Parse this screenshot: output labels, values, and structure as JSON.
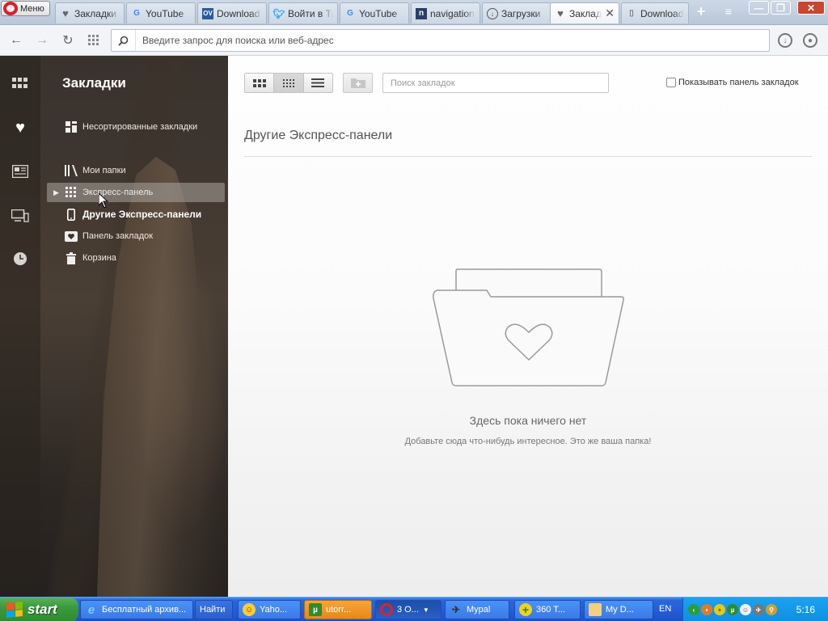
{
  "browser": {
    "menu_label": "Меню",
    "tabs": [
      {
        "label": "Закладки",
        "icon": "heart-icon"
      },
      {
        "label": "YouTube",
        "icon": "google-icon"
      },
      {
        "label": "Download",
        "icon": "ov-icon"
      },
      {
        "label": "Войти в Tr",
        "icon": "twitter-icon"
      },
      {
        "label": "YouTube",
        "icon": "google-icon"
      },
      {
        "label": "navigation",
        "icon": "n-icon"
      },
      {
        "label": "Загрузки",
        "icon": "download-icon"
      },
      {
        "label": "Закладки",
        "icon": "heart-icon",
        "active": true
      },
      {
        "label": "Download",
        "icon": "page-icon"
      }
    ],
    "address_placeholder": "Введите запрос для поиска или веб-адрес"
  },
  "sidebar": {
    "title": "Закладки",
    "items": [
      {
        "label": "Несортированные закладки",
        "icon": "unsorted-icon"
      },
      {
        "label": "Мои папки",
        "icon": "folders-icon"
      },
      {
        "label": "Экспресс-панель",
        "icon": "speed-dial-icon",
        "hovered": true
      },
      {
        "label": "Другие Экспресс-панели",
        "icon": "phone-icon",
        "selected": true
      },
      {
        "label": "Панель закладок",
        "icon": "heart-icon"
      },
      {
        "label": "Корзина",
        "icon": "trash-icon"
      }
    ]
  },
  "main": {
    "search_placeholder": "Поиск закладок",
    "show_bar_label": "Показывать панель закладок",
    "show_bar_checked": false,
    "section_title": "Другие Экспресс-панели",
    "empty_title": "Здесь пока ничего нет",
    "empty_subtitle": "Добавьте сюда что-нибудь интересное. Это же ваша папка!",
    "active_view": "medium-grid"
  },
  "taskbar": {
    "start_label": "start",
    "tasks": [
      {
        "label": "Бесплатный архив...",
        "icon": "ie-icon"
      },
      {
        "label": "Найти",
        "icon": ""
      },
      {
        "label": "Yaho...",
        "icon": "yahoo-icon"
      },
      {
        "label": "utorr...",
        "icon": "utorrent-icon"
      },
      {
        "label": "3 O...",
        "icon": "opera-icon"
      },
      {
        "label": "Mypal",
        "icon": "mypal-icon"
      },
      {
        "label": "360 T...",
        "icon": "360-icon"
      },
      {
        "label": "My D...",
        "icon": "folder-icon"
      }
    ],
    "language": "EN",
    "clock": "5:16"
  },
  "colors": {
    "opera_red": "#d8202a",
    "taskbar_blue": "#245edb",
    "start_green": "#3b9a3d",
    "tray_blue": "#0f8fe0"
  }
}
